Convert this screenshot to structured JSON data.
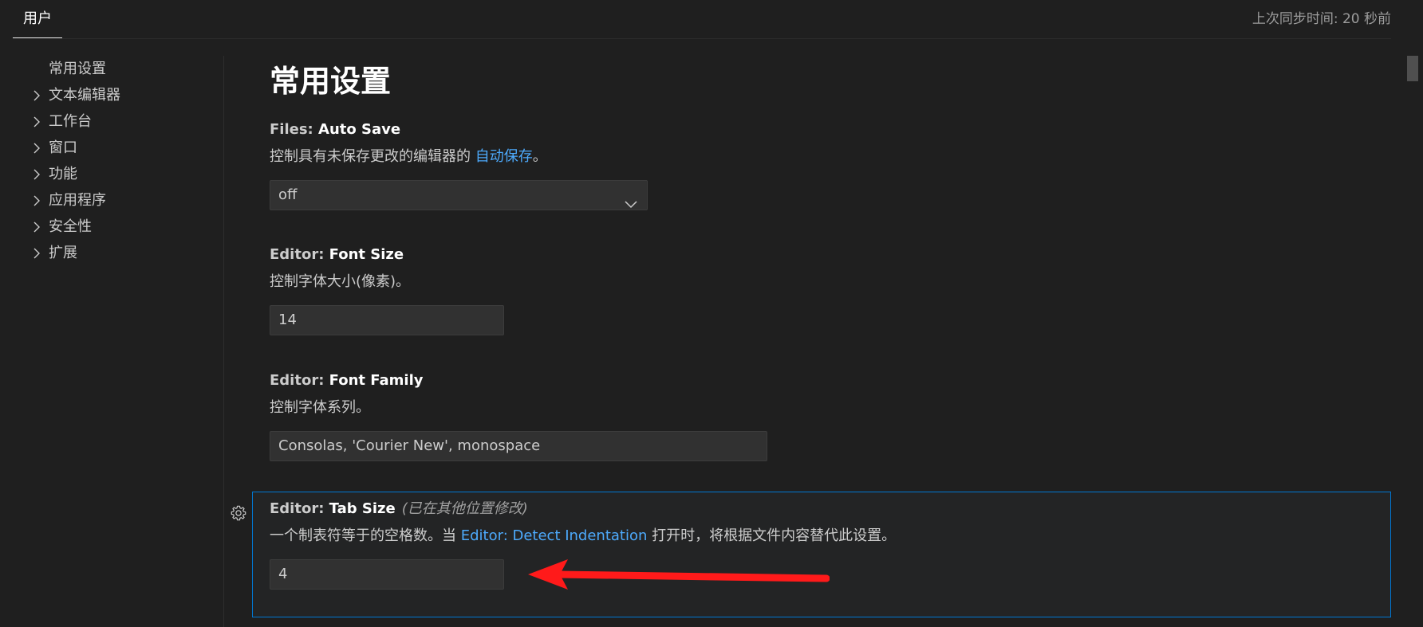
{
  "header": {
    "tab_user": "用户",
    "sync_status": "上次同步时间: 20 秒前"
  },
  "toc": {
    "items": [
      {
        "label": "常用设置",
        "expandable": false
      },
      {
        "label": "文本编辑器",
        "expandable": true
      },
      {
        "label": "工作台",
        "expandable": true
      },
      {
        "label": "窗口",
        "expandable": true
      },
      {
        "label": "功能",
        "expandable": true
      },
      {
        "label": "应用程序",
        "expandable": true
      },
      {
        "label": "安全性",
        "expandable": true
      },
      {
        "label": "扩展",
        "expandable": true
      }
    ]
  },
  "main": {
    "title": "常用设置",
    "settings": {
      "auto_save": {
        "category": "Files: ",
        "key": "Auto Save",
        "desc_before": "控制具有未保存更改的编辑器的 ",
        "desc_link": "自动保存",
        "desc_after": "。",
        "value": "off"
      },
      "font_size": {
        "category": "Editor: ",
        "key": "Font Size",
        "desc": "控制字体大小(像素)。",
        "value": "14"
      },
      "font_family": {
        "category": "Editor: ",
        "key": "Font Family",
        "desc": "控制字体系列。",
        "value": "Consolas, 'Courier New', monospace"
      },
      "tab_size": {
        "category": "Editor: ",
        "key": "Tab Size",
        "modified": "(已在其他位置修改)",
        "desc_before": "一个制表符等于的空格数。当 ",
        "desc_link": "Editor: Detect Indentation",
        "desc_after": " 打开时，将根据文件内容替代此设置。",
        "value": "4"
      }
    }
  },
  "colors": {
    "background": "#1f1f1f",
    "focus_border": "#0078d4",
    "link": "#4daafc",
    "annotation_arrow": "#ff1a1a"
  },
  "icons": {
    "toc_expand": "chevron-right-icon",
    "select": "chevron-down-icon",
    "setting_menu": "gear-icon"
  }
}
